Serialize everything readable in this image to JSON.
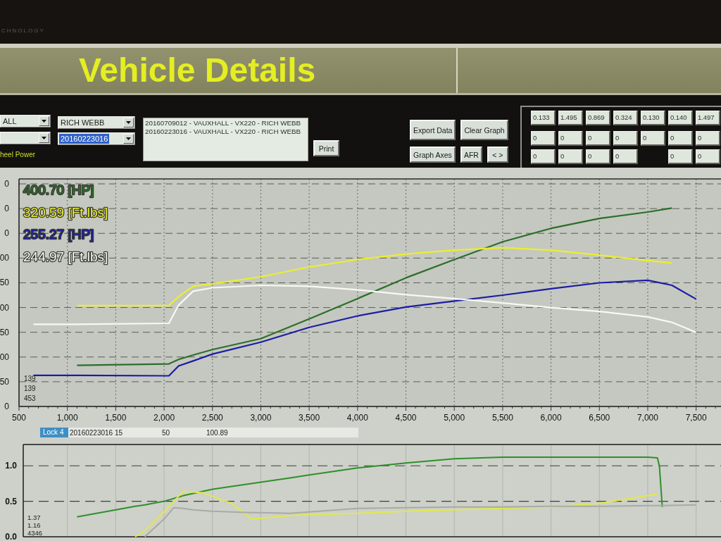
{
  "monitor_bezel": {
    "brand_text": "CHNOLOGY"
  },
  "window": {
    "title": "Vehicle Details"
  },
  "selectors": {
    "dropdowns": [
      {
        "value": "ALL",
        "highlighted": false
      },
      {
        "highlighted": false
      },
      {
        "value": "RICH WEBB",
        "highlighted": false
      },
      {
        "value": "20160223016",
        "highlighted": true
      }
    ],
    "mode_label": "heel Power"
  },
  "runs_list": {
    "items": [
      {
        "label": "20160709012 - VAUXHALL - VX220 - RICH WEBB",
        "selected": false
      },
      {
        "label": "20160223016 - VAUXHALL - VX220 - RICH WEBB",
        "selected": false
      }
    ]
  },
  "print_button": "Print",
  "buttons": [
    [
      "Export Data",
      "Clear Graph"
    ],
    [
      "Graph Axes",
      "AFR",
      "< >"
    ]
  ],
  "value_grid": {
    "rows": [
      [
        {
          "kind": "field",
          "value": "0.133"
        },
        {
          "kind": "field",
          "value": "1.495"
        },
        {
          "kind": "field",
          "value": "0.869"
        },
        {
          "kind": "field",
          "value": "0.324"
        },
        {
          "kind": "field",
          "value": "0.130"
        },
        {
          "kind": "field",
          "value": "0.140"
        },
        {
          "kind": "field",
          "value": "1.497"
        }
      ],
      [
        {
          "kind": "field",
          "value": "0"
        },
        {
          "kind": "field",
          "value": "0"
        },
        {
          "kind": "field",
          "value": "0"
        },
        {
          "kind": "field",
          "value": "0"
        },
        {
          "kind": "field",
          "value": "0"
        },
        {
          "kind": "field",
          "value": "0"
        },
        {
          "kind": "field",
          "value": "0"
        }
      ],
      [
        {
          "kind": "field",
          "value": "0"
        },
        {
          "kind": "field",
          "value": "0"
        },
        {
          "kind": "field",
          "value": "0"
        },
        {
          "kind": "field",
          "value": "0"
        },
        {
          "kind": "gap"
        },
        {
          "kind": "field",
          "value": "0"
        },
        {
          "kind": "field",
          "value": "0"
        }
      ]
    ]
  },
  "power_chart": {
    "chart_data": {
      "type": "line",
      "xlim": [
        500,
        7750
      ],
      "ylim": [
        0,
        460
      ],
      "grid": true,
      "xticks": [
        {
          "value": 500,
          "label": "500"
        },
        {
          "value": 1000,
          "label": "1,000"
        },
        {
          "value": 1500,
          "label": "1,500"
        },
        {
          "value": 2000,
          "label": "2,000"
        },
        {
          "value": 2500,
          "label": "2,500"
        },
        {
          "value": 3000,
          "label": "3,000"
        },
        {
          "value": 3500,
          "label": "3,500"
        },
        {
          "value": 4000,
          "label": "4,000"
        },
        {
          "value": 4500,
          "label": "4,500"
        },
        {
          "value": 5000,
          "label": "5,000"
        },
        {
          "value": 5500,
          "label": "5,500"
        },
        {
          "value": 6000,
          "label": "6,000"
        },
        {
          "value": 6500,
          "label": "6,500"
        },
        {
          "value": 7000,
          "label": "7,000"
        },
        {
          "value": 7500,
          "label": "7,500"
        }
      ],
      "yticks": [
        {
          "value": 0,
          "label": "0"
        },
        {
          "value": 50,
          "label": "50"
        }
      ],
      "x": [
        650,
        1100,
        2050,
        2150,
        2300,
        2500,
        3000,
        3500,
        4000,
        4500,
        5000,
        5500,
        6000,
        6500,
        7000,
        7250,
        7500
      ],
      "series": [
        {
          "name": "400.70 [HP]",
          "color": "#2d6e2a",
          "values": [
            null,
            83,
            86,
            95,
            104,
            115,
            137,
            177,
            218,
            260,
            297,
            333,
            360,
            380,
            393,
            401,
            null
          ]
        },
        {
          "name": "320.59 [Ft.lbs]",
          "color": "#ecee2e",
          "values": [
            null,
            204,
            204,
            222,
            243,
            248,
            262,
            282,
            297,
            308,
            316,
            321,
            316,
            306,
            295,
            290,
            null
          ]
        },
        {
          "name": "255.27 [HP]",
          "color": "#1c1ca6",
          "values": [
            63,
            63,
            62,
            82,
            92,
            106,
            130,
            160,
            183,
            201,
            213,
            225,
            238,
            250,
            255,
            245,
            217
          ]
        },
        {
          "name": "244.97 [Ft.lbs]",
          "color": "#f8f8f4",
          "values": [
            166,
            166,
            168,
            205,
            233,
            240,
            245,
            243,
            236,
            226,
            218,
            209,
            200,
            192,
            181,
            170,
            150
          ]
        }
      ]
    },
    "cut_y_labels": [
      "0",
      "0",
      "0",
      "00",
      "50",
      "00",
      "50",
      "00"
    ],
    "readouts": [
      "139",
      "139",
      "453"
    ]
  },
  "lock_bar": {
    "tag": "Lock 4",
    "values": [
      "20160223016 15",
      "50",
      "100.89"
    ]
  },
  "ratio_chart": {
    "chart_data": {
      "type": "line",
      "xlim": [
        500,
        7750
      ],
      "ylim": [
        0,
        1.3
      ],
      "grid": true,
      "yticks": [
        {
          "value": 0,
          "label": "0.0"
        },
        {
          "value": 0.5,
          "label": "0.5"
        },
        {
          "value": 1,
          "label": "1.0"
        }
      ],
      "x": [
        1100,
        1500,
        1700,
        1800,
        2000,
        2100,
        2200,
        2300,
        2400,
        2500,
        2700,
        2900,
        3000,
        3300,
        3500,
        4000,
        4500,
        5000,
        5500,
        6000,
        6500,
        7000,
        7100,
        7120,
        7150,
        7500
      ],
      "series": [
        {
          "color": "#2f8f2c",
          "values": [
            0.28,
            0.38,
            0.43,
            0.45,
            0.5,
            0.54,
            0.58,
            0.61,
            0.64,
            0.67,
            0.71,
            0.75,
            0.77,
            0.83,
            0.87,
            0.97,
            1.04,
            1.1,
            1.12,
            1.12,
            1.12,
            1.12,
            1.11,
            1.0,
            0.42,
            null
          ]
        },
        {
          "color": "#e2e84c",
          "values": [
            null,
            null,
            0,
            0.08,
            0.35,
            0.5,
            0.64,
            0.63,
            0.62,
            0.57,
            0.47,
            0.25,
            0.26,
            0.3,
            0.31,
            0.33,
            0.36,
            0.38,
            0.4,
            0.42,
            0.47,
            0.58,
            0.6,
            null,
            null,
            null
          ]
        },
        {
          "color": "#a9aaa6",
          "values": [
            null,
            null,
            null,
            0,
            0.25,
            0.41,
            0.4,
            0.38,
            0.37,
            0.36,
            0.35,
            0.34,
            0.34,
            0.33,
            0.35,
            0.4,
            0.41,
            0.42,
            0.42,
            0.43,
            0.43,
            0.44,
            0.44,
            0.44,
            0.44,
            0.45
          ]
        }
      ]
    },
    "readouts": [
      "1.37",
      "1.16",
      "4346"
    ]
  }
}
